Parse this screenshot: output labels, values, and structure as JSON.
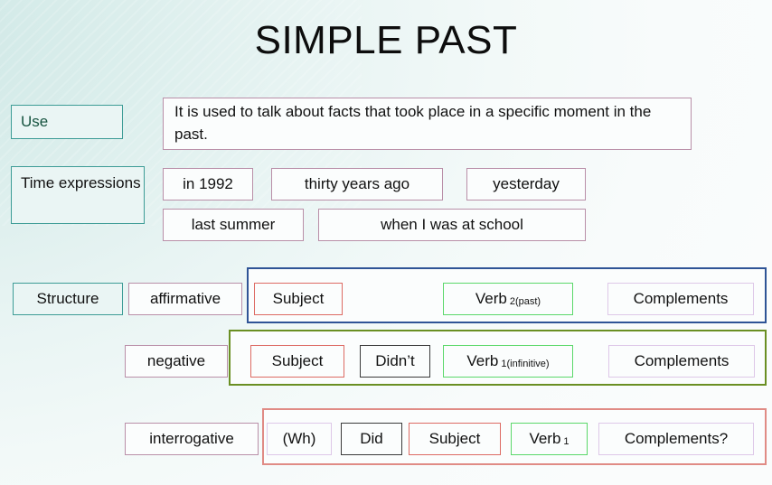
{
  "title": "SIMPLE PAST",
  "use": {
    "label": "Use",
    "description": "It is used to talk about facts that took place in a specific moment in the past."
  },
  "time_expressions": {
    "label": "Time expressions",
    "items": [
      "in 1992",
      "thirty years ago",
      "yesterday",
      "last summer",
      "when I was at school"
    ]
  },
  "structure": {
    "label": "Structure",
    "rows": [
      {
        "type": "affirmative",
        "cells": [
          {
            "text": "Subject",
            "sub": ""
          },
          {
            "text": "Verb",
            "sub": "2(past)"
          },
          {
            "text": "Complements",
            "sub": ""
          }
        ]
      },
      {
        "type": "negative",
        "cells": [
          {
            "text": "Subject",
            "sub": ""
          },
          {
            "text": "Didn’t",
            "sub": ""
          },
          {
            "text": "Verb",
            "sub": "1(infinitive)"
          },
          {
            "text": "Complements",
            "sub": ""
          }
        ]
      },
      {
        "type": "interrogative",
        "cells": [
          {
            "text": "(Wh)",
            "sub": ""
          },
          {
            "text": "Did",
            "sub": ""
          },
          {
            "text": "Subject",
            "sub": ""
          },
          {
            "text": "Verb",
            "sub": "1"
          },
          {
            "text": "Complements?",
            "sub": ""
          }
        ]
      }
    ]
  },
  "colors": {
    "background_start": "#cfe8e6",
    "background_end": "#fafcfc",
    "teal_border": "#3d9c96",
    "mauve_border": "#b98fa8",
    "red_border": "#dd6a63",
    "green_border": "#5bd86a",
    "lilac_border": "#dec8e8",
    "dark_border": "#3a3a3a",
    "frame_blue": "#2f5496",
    "frame_olive": "#6a8f23",
    "frame_salmon": "#e08b85",
    "use_label_text": "#16533f"
  }
}
